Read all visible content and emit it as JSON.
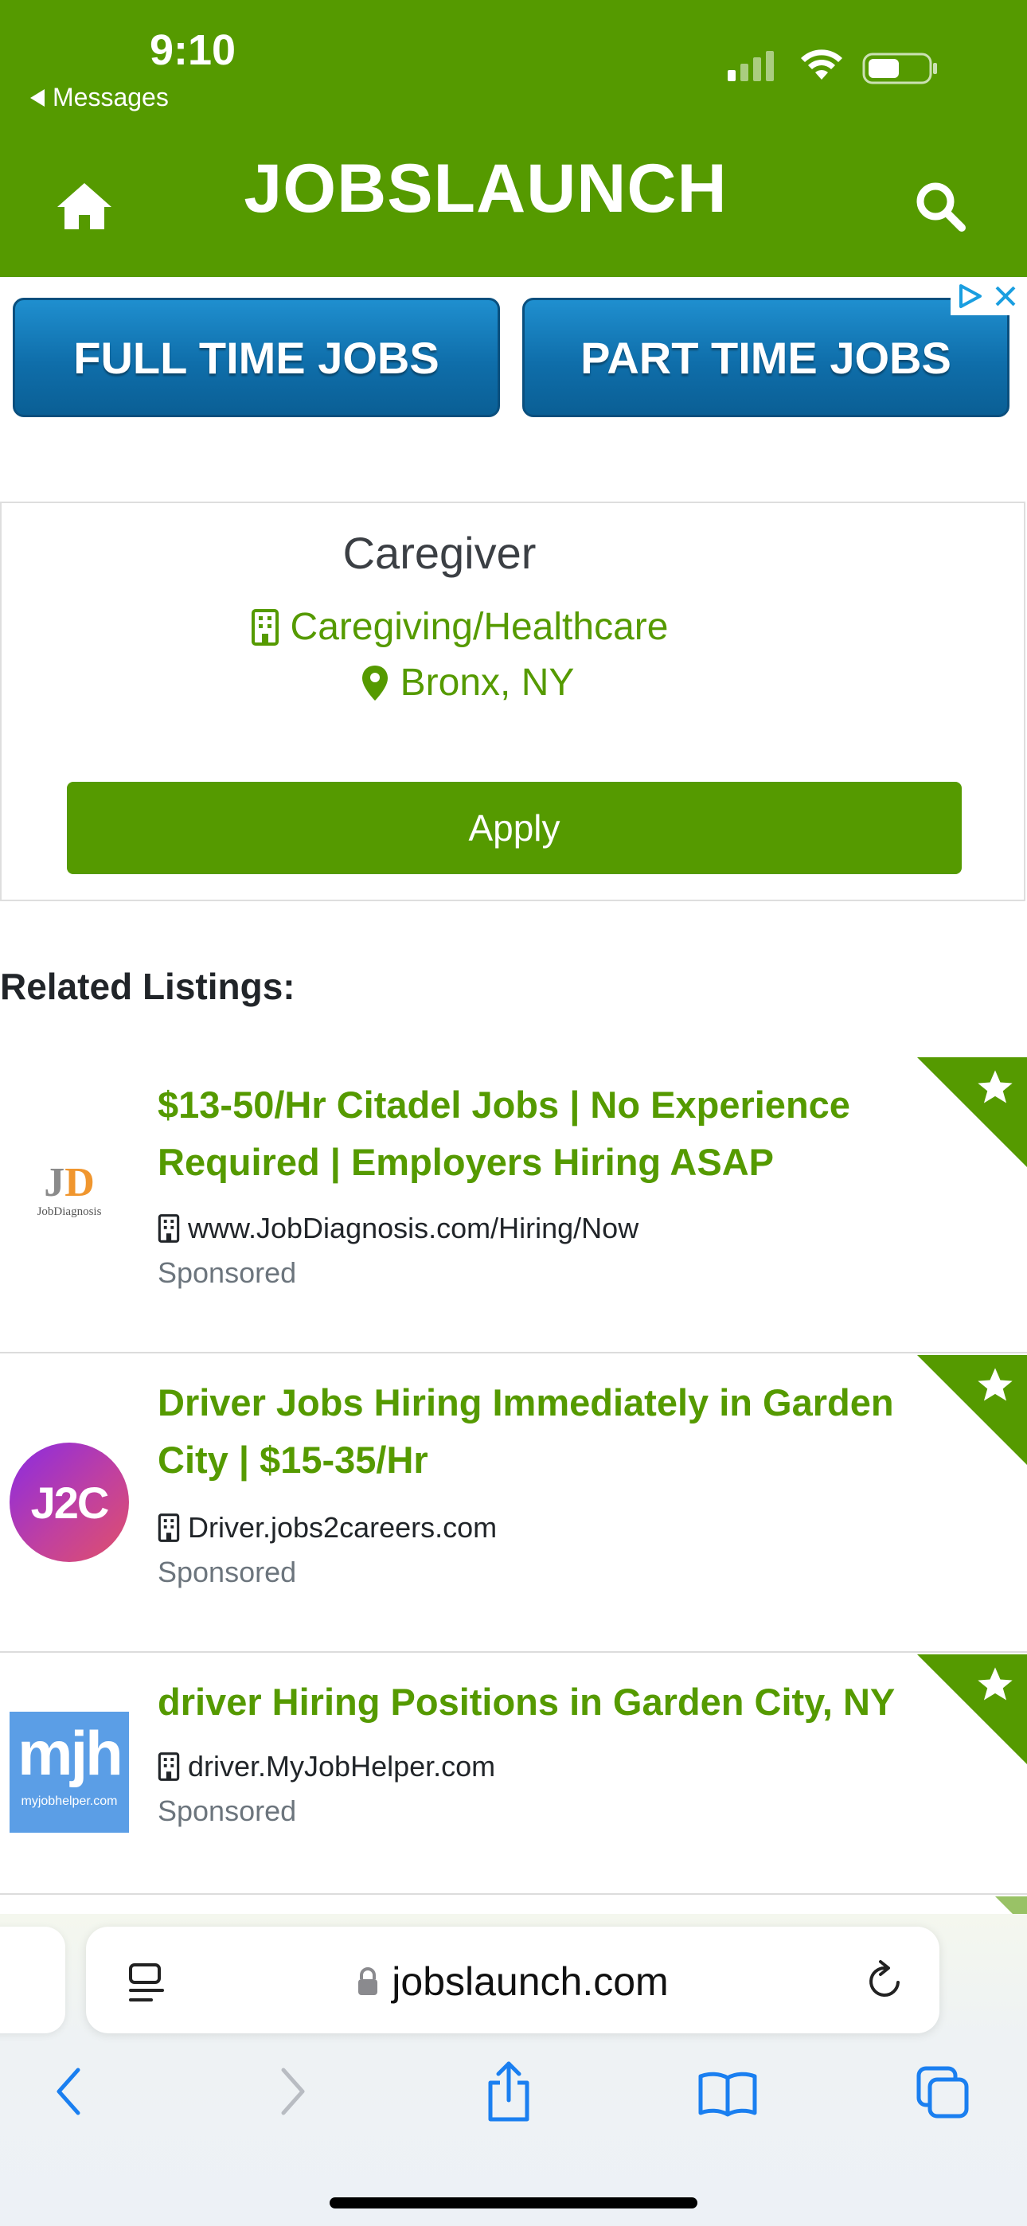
{
  "status_bar": {
    "time": "9:10",
    "back_label": "Messages"
  },
  "header": {
    "brand": "JOBSLAUNCH",
    "home_icon": "home-icon",
    "search_icon": "search-icon"
  },
  "ad": {
    "left_label": "FULL TIME JOBS",
    "right_label": "PART TIME JOBS"
  },
  "job": {
    "title": "Caregiver",
    "category": "Caregiving/Healthcare",
    "location": "Bronx, NY",
    "apply_label": "Apply"
  },
  "related": {
    "heading": "Related Listings:",
    "items": [
      {
        "title": "$13-50/Hr Citadel Jobs | No Experience Required | Employers Hiring ASAP",
        "source": "www.JobDiagnosis.com/Hiring/Now",
        "sponsored": "Sponsored",
        "logo_text": "JD",
        "logo_sub": "JobDiagnosis"
      },
      {
        "title": "Driver Jobs Hiring Immediately in Garden City | $15-35/Hr",
        "source": "Driver.jobs2careers.com",
        "sponsored": "Sponsored",
        "logo_text": "J2C"
      },
      {
        "title": "driver Hiring Positions in Garden City, NY",
        "source": "driver.MyJobHelper.com",
        "sponsored": "Sponsored",
        "logo_text": "mjh",
        "logo_sub": "myjobhelper.com"
      }
    ]
  },
  "browser": {
    "url": "jobslaunch.com"
  },
  "colors": {
    "brand_green": "#559a00",
    "ad_blue": "#0f6eaa",
    "ios_blue": "#1a7ff0"
  }
}
